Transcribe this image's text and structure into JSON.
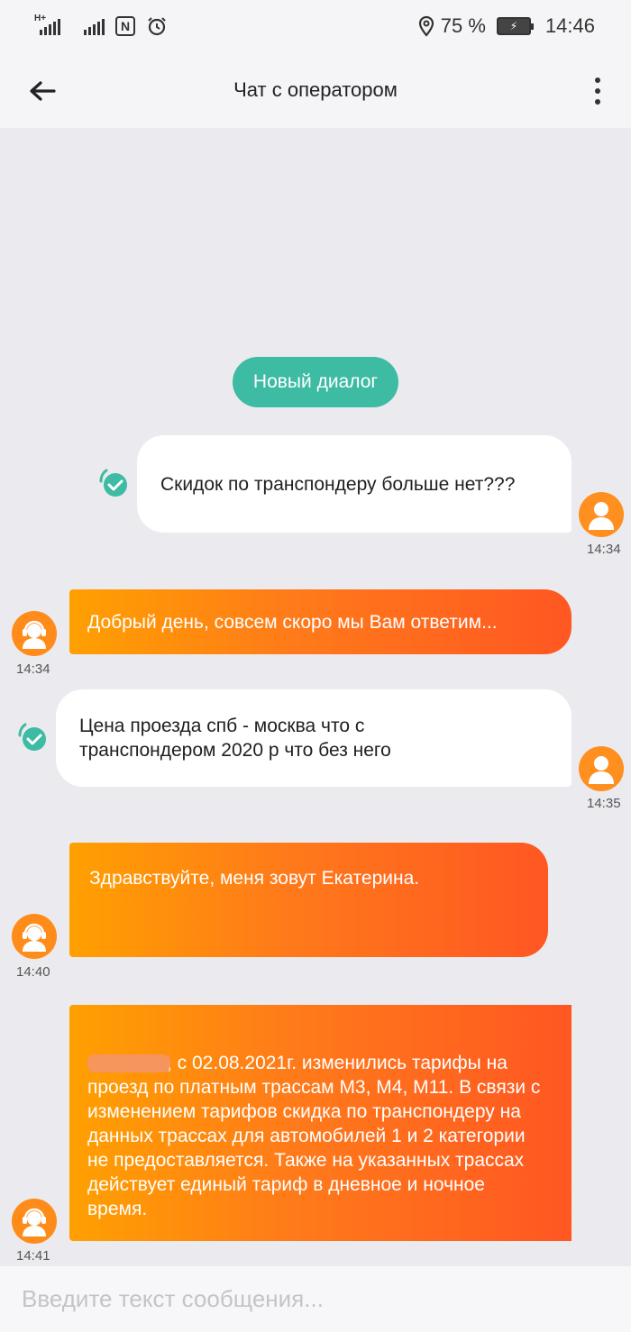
{
  "status_bar": {
    "network_label": "H+",
    "battery_percent": "75 %",
    "time": "14:46",
    "nfc_label": "N",
    "icons": [
      "signal-icon",
      "signal-icon",
      "nfc-icon",
      "alarm-icon",
      "location-icon",
      "battery-icon"
    ]
  },
  "header": {
    "title": "Чат с оператором",
    "back_icon": "arrow-left-icon",
    "menu_icon": "more-vertical-icon"
  },
  "new_dialog_label": "Новый диалог",
  "messages": [
    {
      "sender": "user",
      "text": "Скидок по транспондеру больше нет???",
      "time": "14:34",
      "status": "delivered"
    },
    {
      "sender": "operator",
      "text": "Добрый день, совсем скоро мы Вам ответим...",
      "time": "14:34"
    },
    {
      "sender": "user",
      "text": "Цена проезда спб - москва что с транспондером 2020 р что без него",
      "time": "14:35",
      "status": "delivered"
    },
    {
      "sender": "operator",
      "text": "Здравствуйте, меня зовут Екатерина.",
      "time": "14:40"
    },
    {
      "sender": "operator",
      "text": ", с 02.08.2021г. изменились тарифы на проезд по платным трассам М3, М4, М11. В связи с изменением тарифов скидка по транспондеру на данных трассах для автомобилей 1 и 2 категории не предоставляется. Также на указанных трассах действует единый тариф в дневное и ночное время.",
      "time": "14:41",
      "redacted_prefix": true
    }
  ],
  "input": {
    "placeholder": "Введите текст сообщения...",
    "value": ""
  },
  "colors": {
    "accent_green": "#3dbba3",
    "operator_gradient_start": "#ffa000",
    "operator_gradient_end": "#ff5722",
    "background": "#ebebef"
  }
}
